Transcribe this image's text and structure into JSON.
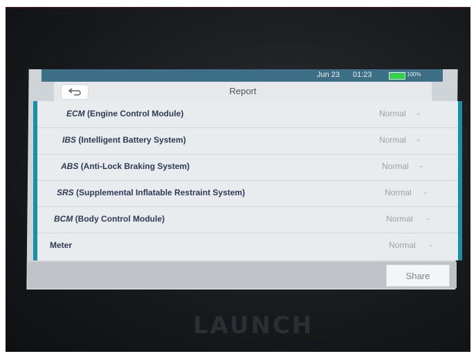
{
  "status_bar": {
    "date": "Jun 23",
    "time": "01:23",
    "battery": "100%"
  },
  "header": {
    "title": "Report",
    "back_icon": "back-arrow-icon"
  },
  "systems": [
    {
      "abbr": "ECM",
      "name": "(Engine Control Module)",
      "status": "Normal"
    },
    {
      "abbr": "IBS",
      "name": "(Intelligent Battery System)",
      "status": "Normal"
    },
    {
      "abbr": "ABS",
      "name": "(Anti-Lock Braking System)",
      "status": "Normal"
    },
    {
      "abbr": "SRS",
      "name": "(Supplemental Inflatable Restraint System)",
      "status": "Normal"
    },
    {
      "abbr": "BCM",
      "name": "(Body Control Module)",
      "status": "Normal"
    },
    {
      "abbr": "Meter",
      "name": "",
      "status": "Normal"
    }
  ],
  "footer": {
    "share_label": "Share"
  },
  "device": {
    "brand": "LAUNCH"
  },
  "colors": {
    "accent": "#1c8fa6",
    "status_bar": "#3d6f86",
    "battery": "#35d246"
  }
}
